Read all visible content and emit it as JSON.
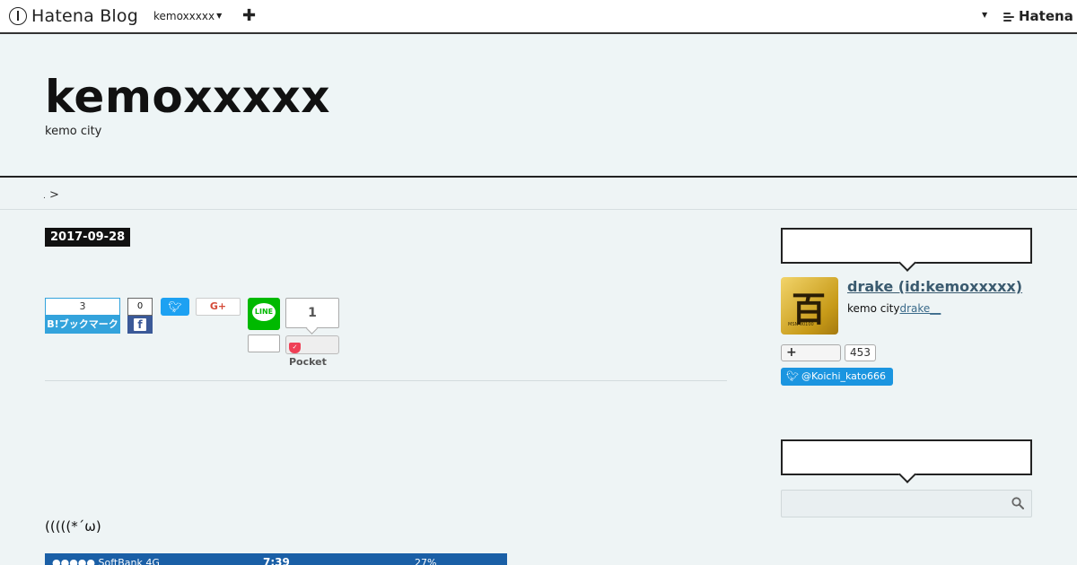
{
  "globalbar": {
    "logo_text": "Hatena Blog",
    "blog_selector": "kemoxxxxx",
    "hatena_label": "Hatena"
  },
  "header": {
    "title": "kemoxxxxx",
    "description": "kemo city"
  },
  "breadcrumb": {
    "separator": ">"
  },
  "entry": {
    "date": "2017-09-28",
    "body_text": "(((((*´ω)",
    "image_status": {
      "carrier": "●●●●● SoftBank 4G",
      "time": "7:39",
      "battery": "27%"
    }
  },
  "share": {
    "hatebu_count": "3",
    "hatebu_label": "B!ブックマーク",
    "facebook_count": "0",
    "googleplus_label": "G+",
    "line_label": "LINE",
    "pocket_count": "1",
    "pocket_label": "Pocket"
  },
  "sidebar": {
    "profile": {
      "name": "drake (id:kemoxxxxx)",
      "desc": "kemo city",
      "desc_link": "drake__",
      "follow_label": "+",
      "follow_count": "453",
      "twitter_handle": "@Koichi_kato666"
    },
    "search": {
      "placeholder": ""
    }
  }
}
